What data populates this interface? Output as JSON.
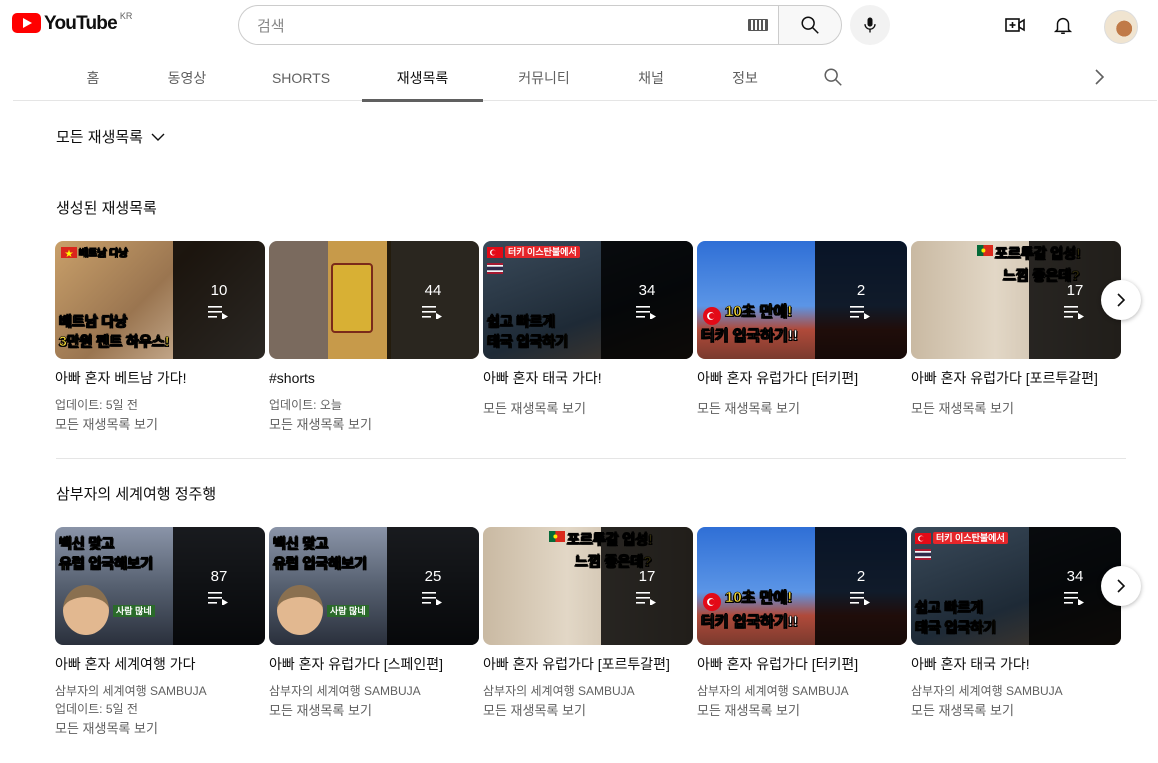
{
  "header": {
    "logo_text": "YouTube",
    "country_code": "KR",
    "search_placeholder": "검색"
  },
  "tabs": [
    {
      "label": "홈",
      "active": false
    },
    {
      "label": "동영상",
      "active": false
    },
    {
      "label": "SHORTS",
      "active": false
    },
    {
      "label": "재생목록",
      "active": true
    },
    {
      "label": "커뮤니티",
      "active": false
    },
    {
      "label": "채널",
      "active": false
    },
    {
      "label": "정보",
      "active": false
    }
  ],
  "filter_label": "모든 재생목록",
  "sections": [
    {
      "title": "생성된 재생목록",
      "cards": [
        {
          "count": "10",
          "title": "아빠 혼자 베트남 가다!",
          "channel": "",
          "updated": "업데이트: 5일 전",
          "link": "모든 재생목록 보기",
          "thumb_lines": [
            "베트남 다낭",
            "3만원 펜트 하우스!"
          ],
          "thumb_tag": "베트남 다낭"
        },
        {
          "count": "44",
          "title": "#shorts",
          "channel": "",
          "updated": "업데이트: 오늘",
          "link": "모든 재생목록 보기",
          "thumb_lines": [],
          "thumb_tag": ""
        },
        {
          "count": "34",
          "title": "아빠 혼자 태국 가다!",
          "channel": "",
          "updated": "",
          "link": "모든 재생목록 보기",
          "thumb_lines": [
            "쉽고 빠르게",
            "태국 입국하기"
          ],
          "thumb_tag": "터키 이스탄불에서"
        },
        {
          "count": "2",
          "title": "아빠 혼자 유럽가다 [터키편]",
          "channel": "",
          "updated": "",
          "link": "모든 재생목록 보기",
          "thumb_lines": [
            "10초 만에!",
            "터키 입국하기!!"
          ],
          "thumb_tag": ""
        },
        {
          "count": "17",
          "title": "아빠 혼자 유럽가다 [포르투갈편]",
          "channel": "",
          "updated": "",
          "link": "모든 재생목록 보기",
          "thumb_lines": [
            "포르투갈 입성!",
            "느낌 좋은데?"
          ],
          "thumb_tag": ""
        }
      ]
    },
    {
      "title": "삼부자의 세계여행 정주행",
      "cards": [
        {
          "count": "87",
          "title": "아빠 혼자 세계여행 가다",
          "channel": "삼부자의 세계여행 SAMBUJA",
          "updated": "업데이트: 5일 전",
          "link": "모든 재생목록 보기",
          "thumb_lines": [
            "백신 맞고",
            "유럽 입국해보기"
          ],
          "thumb_tag": "사람 많네"
        },
        {
          "count": "25",
          "title": "아빠 혼자 유럽가다 [스페인편]",
          "channel": "삼부자의 세계여행 SAMBUJA",
          "updated": "",
          "link": "모든 재생목록 보기",
          "thumb_lines": [
            "백신 맞고",
            "유럽 입국해보기"
          ],
          "thumb_tag": "사람 많네"
        },
        {
          "count": "17",
          "title": "아빠 혼자 유럽가다 [포르투갈편]",
          "channel": "삼부자의 세계여행 SAMBUJA",
          "updated": "",
          "link": "모든 재생목록 보기",
          "thumb_lines": [
            "포르투갈 입성!",
            "느낌 좋은데?"
          ],
          "thumb_tag": ""
        },
        {
          "count": "2",
          "title": "아빠 혼자 유럽가다 [터키편]",
          "channel": "삼부자의 세계여행 SAMBUJA",
          "updated": "",
          "link": "모든 재생목록 보기",
          "thumb_lines": [
            "10초 만에!",
            "터키 입국하기!!"
          ],
          "thumb_tag": ""
        },
        {
          "count": "34",
          "title": "아빠 혼자 태국 가다!",
          "channel": "삼부자의 세계여행 SAMBUJA",
          "updated": "",
          "link": "모든 재생목록 보기",
          "thumb_lines": [
            "쉽고 빠르게",
            "태국 입국하기"
          ],
          "thumb_tag": "터키 이스탄불에서"
        }
      ]
    }
  ],
  "colors": {
    "brand_red": "#ff0000",
    "text_primary": "#0f0f0f",
    "text_secondary": "#606060",
    "divider": "#e5e5e5"
  },
  "icons": [
    "youtube-logo-icon",
    "keyboard-icon",
    "search-icon",
    "mic-icon",
    "create-video-icon",
    "notification-bell-icon",
    "avatar",
    "chevron-down-icon",
    "chevron-right-icon",
    "playlist-icon"
  ]
}
